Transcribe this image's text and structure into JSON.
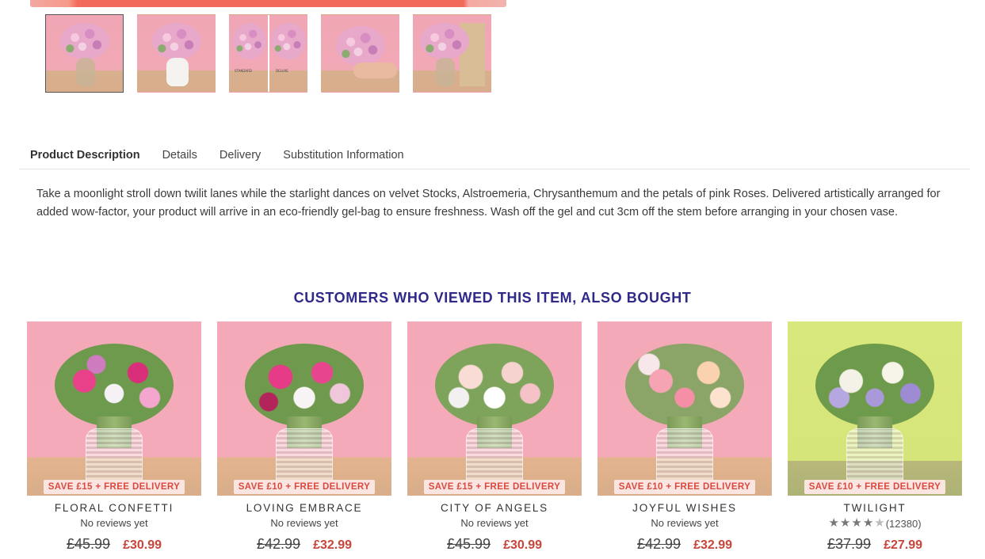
{
  "thumbnails": [
    {
      "alt": "Bouquet in vase"
    },
    {
      "alt": "Bouquet in white vase"
    },
    {
      "alt": "Size comparison",
      "labels": [
        "STANDARD",
        "DELUXE"
      ]
    },
    {
      "alt": "Bouquet held in hand"
    },
    {
      "alt": "Bouquet with gift card"
    }
  ],
  "tabs": [
    "Product Description",
    "Details",
    "Delivery",
    "Substitution Information"
  ],
  "description": "Take a moonlight stroll down twilit lanes while the starlight dances on velvet Stocks, Alstroemeria, Chrysanthemum and the petals of pink Roses. Delivered artistically arranged for added wow-factor, your product will arrive in an eco-friendly gel-bag to ensure freshness. Wash off the gel and cut 3cm off the stem before arranging in your chosen vase.",
  "section_title": "CUSTOMERS WHO VIEWED THIS ITEM, ALSO BOUGHT",
  "products": [
    {
      "name": "FLORAL CONFETTI",
      "promo": "SAVE £15 + FREE DELIVERY",
      "reviews": "No reviews yet",
      "was": "£45.99",
      "now": "£30.99"
    },
    {
      "name": "LOVING EMBRACE",
      "promo": "SAVE £10 + FREE DELIVERY",
      "reviews": "No reviews yet",
      "was": "£42.99",
      "now": "£32.99"
    },
    {
      "name": "CITY OF ANGELS",
      "promo": "SAVE £15 + FREE DELIVERY",
      "reviews": "No reviews yet",
      "was": "£45.99",
      "now": "£30.99"
    },
    {
      "name": "JOYFUL WISHES",
      "promo": "SAVE £10 + FREE DELIVERY",
      "reviews": "No reviews yet",
      "was": "£42.99",
      "now": "£32.99"
    },
    {
      "name": "TWILIGHT",
      "promo": "SAVE £10 + FREE DELIVERY",
      "rating": 4.5,
      "review_count": "(12380)",
      "was": "£37.99",
      "now": "£27.99"
    }
  ],
  "colors": {
    "title": "#2f2a8a",
    "price_now": "#c9443a",
    "promo_text": "#d84a3f"
  }
}
